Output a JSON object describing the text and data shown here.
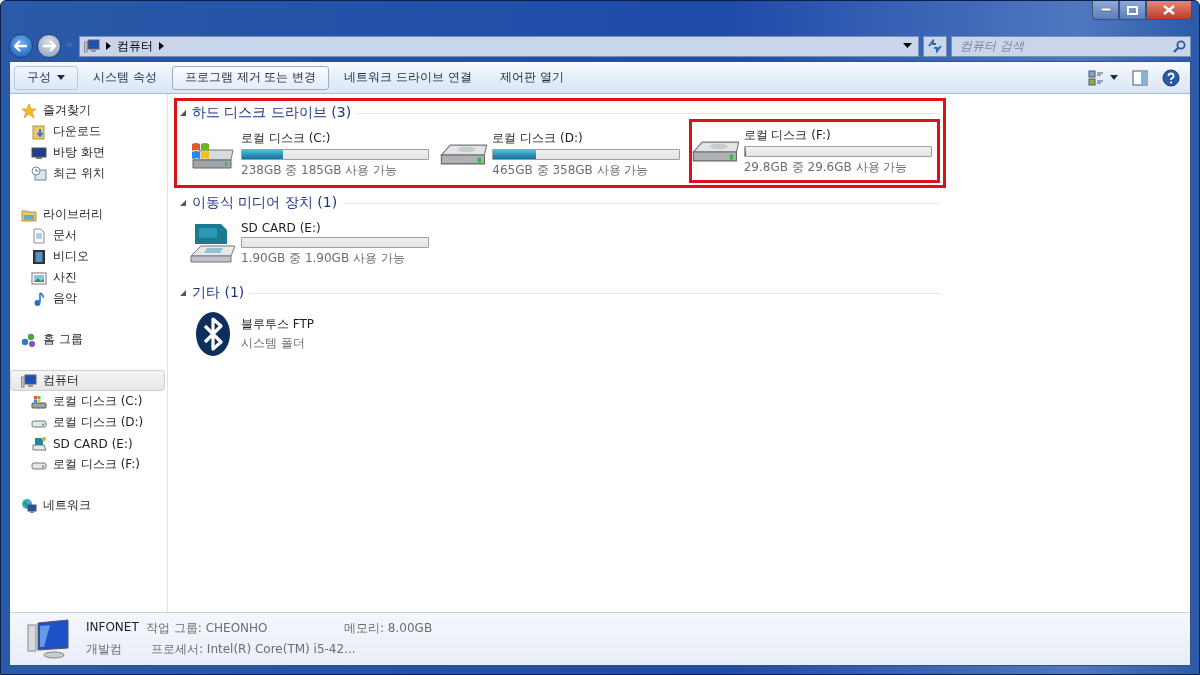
{
  "address": {
    "crumbs": [
      "컴퓨터"
    ]
  },
  "search": {
    "placeholder": "컴퓨터 검색"
  },
  "toolbar": [
    {
      "label": "구성",
      "menu": true,
      "hovered": false
    },
    {
      "label": "시스템 속성",
      "menu": false,
      "hovered": false
    },
    {
      "label": "프로그램 제거 또는 변경",
      "menu": false,
      "hovered": true
    },
    {
      "label": "네트워크 드라이브 연결",
      "menu": false,
      "hovered": false
    },
    {
      "label": "제어판 열기",
      "menu": false,
      "hovered": false
    }
  ],
  "nav": [
    {
      "label": "즐겨찾기",
      "kind": "favorites",
      "selected": false,
      "children": [
        {
          "label": "다운로드",
          "kind": "downloads",
          "selected": false
        },
        {
          "label": "바탕 화면",
          "kind": "desktop",
          "selected": false
        },
        {
          "label": "최근 위치",
          "kind": "recent",
          "selected": false
        }
      ]
    },
    {
      "label": "라이브러리",
      "kind": "libraries",
      "selected": false,
      "children": [
        {
          "label": "문서",
          "kind": "documents",
          "selected": false
        },
        {
          "label": "비디오",
          "kind": "videos",
          "selected": false
        },
        {
          "label": "사진",
          "kind": "pictures",
          "selected": false
        },
        {
          "label": "음악",
          "kind": "music",
          "selected": false
        }
      ]
    },
    {
      "label": "홈 그룹",
      "kind": "homegroup",
      "selected": false
    },
    {
      "label": "컴퓨터",
      "kind": "computer",
      "selected": true,
      "children": [
        {
          "label": "로컬 디스크 (C:)",
          "kind": "system-drive",
          "selected": false
        },
        {
          "label": "로컬 디스크 (D:)",
          "kind": "hdd",
          "selected": false
        },
        {
          "label": "SD CARD (E:)",
          "kind": "sd",
          "selected": false
        },
        {
          "label": "로컬 디스크 (F:)",
          "kind": "hdd",
          "selected": false
        }
      ]
    },
    {
      "label": "네트워크",
      "kind": "network",
      "selected": false
    }
  ],
  "groups": [
    {
      "title": "하드 디스크 드라이브 (3)",
      "highlighted": true,
      "items": [
        {
          "kind": "system-drive",
          "name": "로컬 디스크 (C:)",
          "level": 0.22,
          "free": "238GB 중 185GB 사용 가능",
          "highlighted": false
        },
        {
          "kind": "hdd",
          "name": "로컬 디스크 (D:)",
          "level": 0.23,
          "free": "465GB 중 358GB 사용 가능",
          "highlighted": false
        },
        {
          "kind": "hdd",
          "name": "로컬 디스크 (F:)",
          "level": 0.007,
          "free": "29.8GB 중 29.6GB 사용 가능",
          "highlighted": true
        }
      ]
    },
    {
      "title": "이동식 미디어 장치 (1)",
      "highlighted": false,
      "items": [
        {
          "kind": "sd",
          "name": "SD CARD (E:)",
          "level": 0.0,
          "free": "1.90GB 중 1.90GB 사용 가능",
          "highlighted": false
        }
      ]
    },
    {
      "title": "기타 (1)",
      "highlighted": false,
      "items": [
        {
          "kind": "bluetooth",
          "name": "블루투스 FTP",
          "subtitle": "시스템 폴더",
          "highlighted": false
        }
      ]
    }
  ],
  "details": {
    "computer_name": "INFONET",
    "description": "개발컴",
    "workgroup": "작업 그룹: CHEONHO",
    "memory": "메모리: 8.00GB",
    "processor": "프로세서: Intel(R) Core(TM) i5-42..."
  }
}
